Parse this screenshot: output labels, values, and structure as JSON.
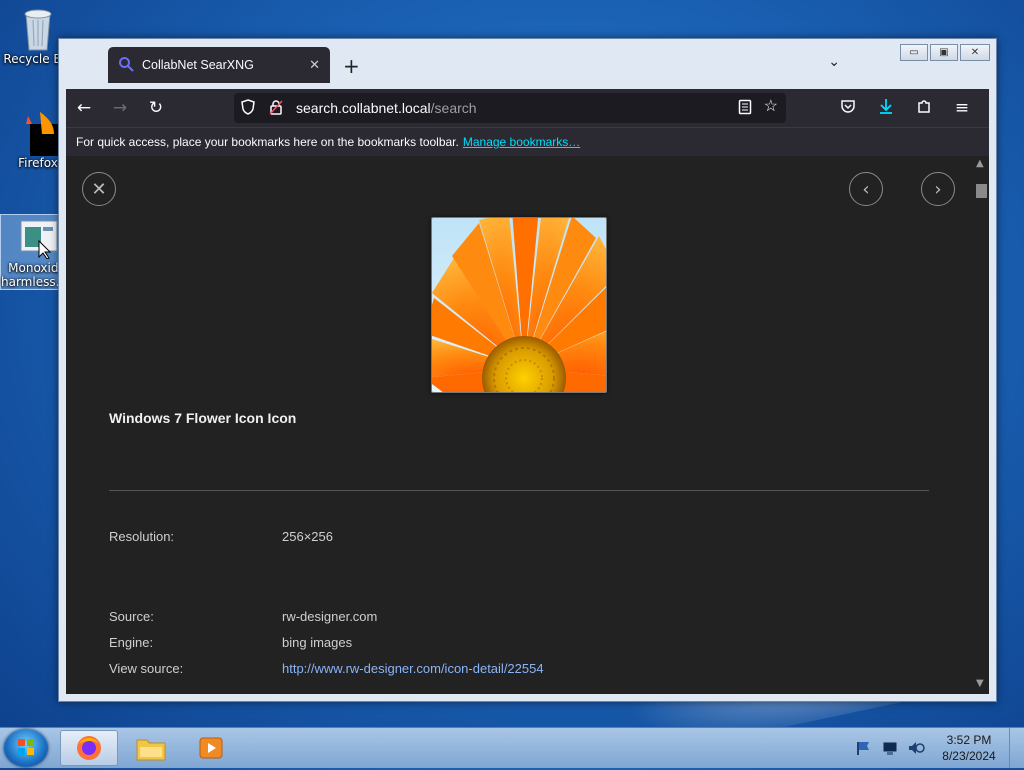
{
  "desktop": {
    "icons": [
      {
        "label": "Recycle Bin"
      },
      {
        "label": "Firefox"
      },
      {
        "label": "Monoxide harmless.exe"
      }
    ]
  },
  "browser": {
    "tab_title": "CollabNet SearXNG",
    "new_tab_symbol": "+",
    "url_host": "search.collabnet.local",
    "url_path": "/search",
    "bookmarks_text": "For quick access, place your bookmarks here on the bookmarks toolbar.",
    "bookmarks_link": "Manage bookmarks…"
  },
  "result": {
    "title": "Windows 7 Flower Icon Icon",
    "resolution_label": "Resolution:",
    "resolution_value": "256×256",
    "source_label": "Source:",
    "source_value": "rw-designer.com",
    "engine_label": "Engine:",
    "engine_value": "bing images",
    "view_source_label": "View source:",
    "view_source_value": "http://www.rw-designer.com/icon-detail/22554"
  },
  "taskbar": {
    "time": "3:52 PM",
    "date": "8/23/2024"
  },
  "colors": {
    "accent_link": "#00ddff",
    "download_icon": "#00ddff",
    "flower_orange": "#ff7a00"
  }
}
